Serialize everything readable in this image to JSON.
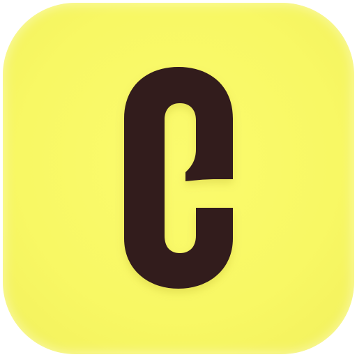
{
  "app_icon": {
    "name": "app-icon",
    "shape": "rounded-square",
    "background_color": "#f8f864",
    "glyph": {
      "name": "c-logo-icon",
      "letter": "c",
      "color": "#311a1e"
    }
  }
}
